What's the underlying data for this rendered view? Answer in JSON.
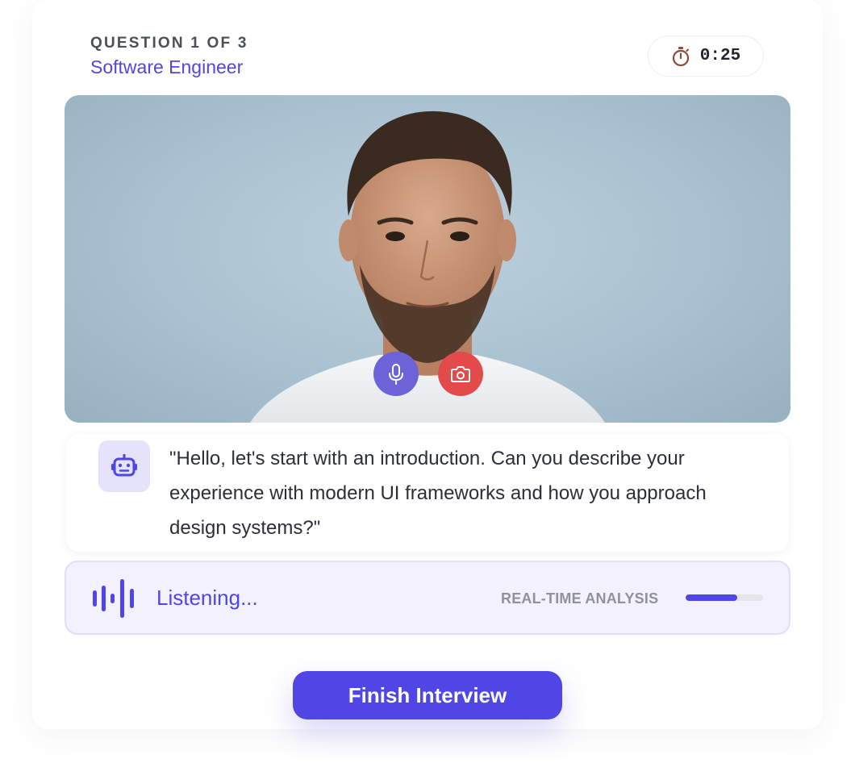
{
  "header": {
    "question_progress": "QUESTION 1 OF 3",
    "role": "Software Engineer",
    "timer": {
      "icon": "stopwatch-icon",
      "value": "0:25"
    }
  },
  "video": {
    "controls": [
      {
        "name": "mic-button",
        "icon": "microphone-icon",
        "color": "#6c63d9"
      },
      {
        "name": "camera-button",
        "icon": "camera-icon",
        "color": "#e34b4b"
      }
    ]
  },
  "prompt": {
    "icon": "robot-icon",
    "text": "\"Hello, let's start with an introduction. Can you describe your experience with modern UI frameworks and how you approach design systems?\""
  },
  "status": {
    "icon": "sound-wave-icon",
    "label": "Listening...",
    "analysis_label": "REAL-TIME ANALYSIS",
    "analysis_progress": 0.67
  },
  "actions": {
    "finish_label": "Finish Interview"
  },
  "colors": {
    "accent": "#4f46e5",
    "danger": "#e34b4b",
    "muted": "#8e929c"
  }
}
